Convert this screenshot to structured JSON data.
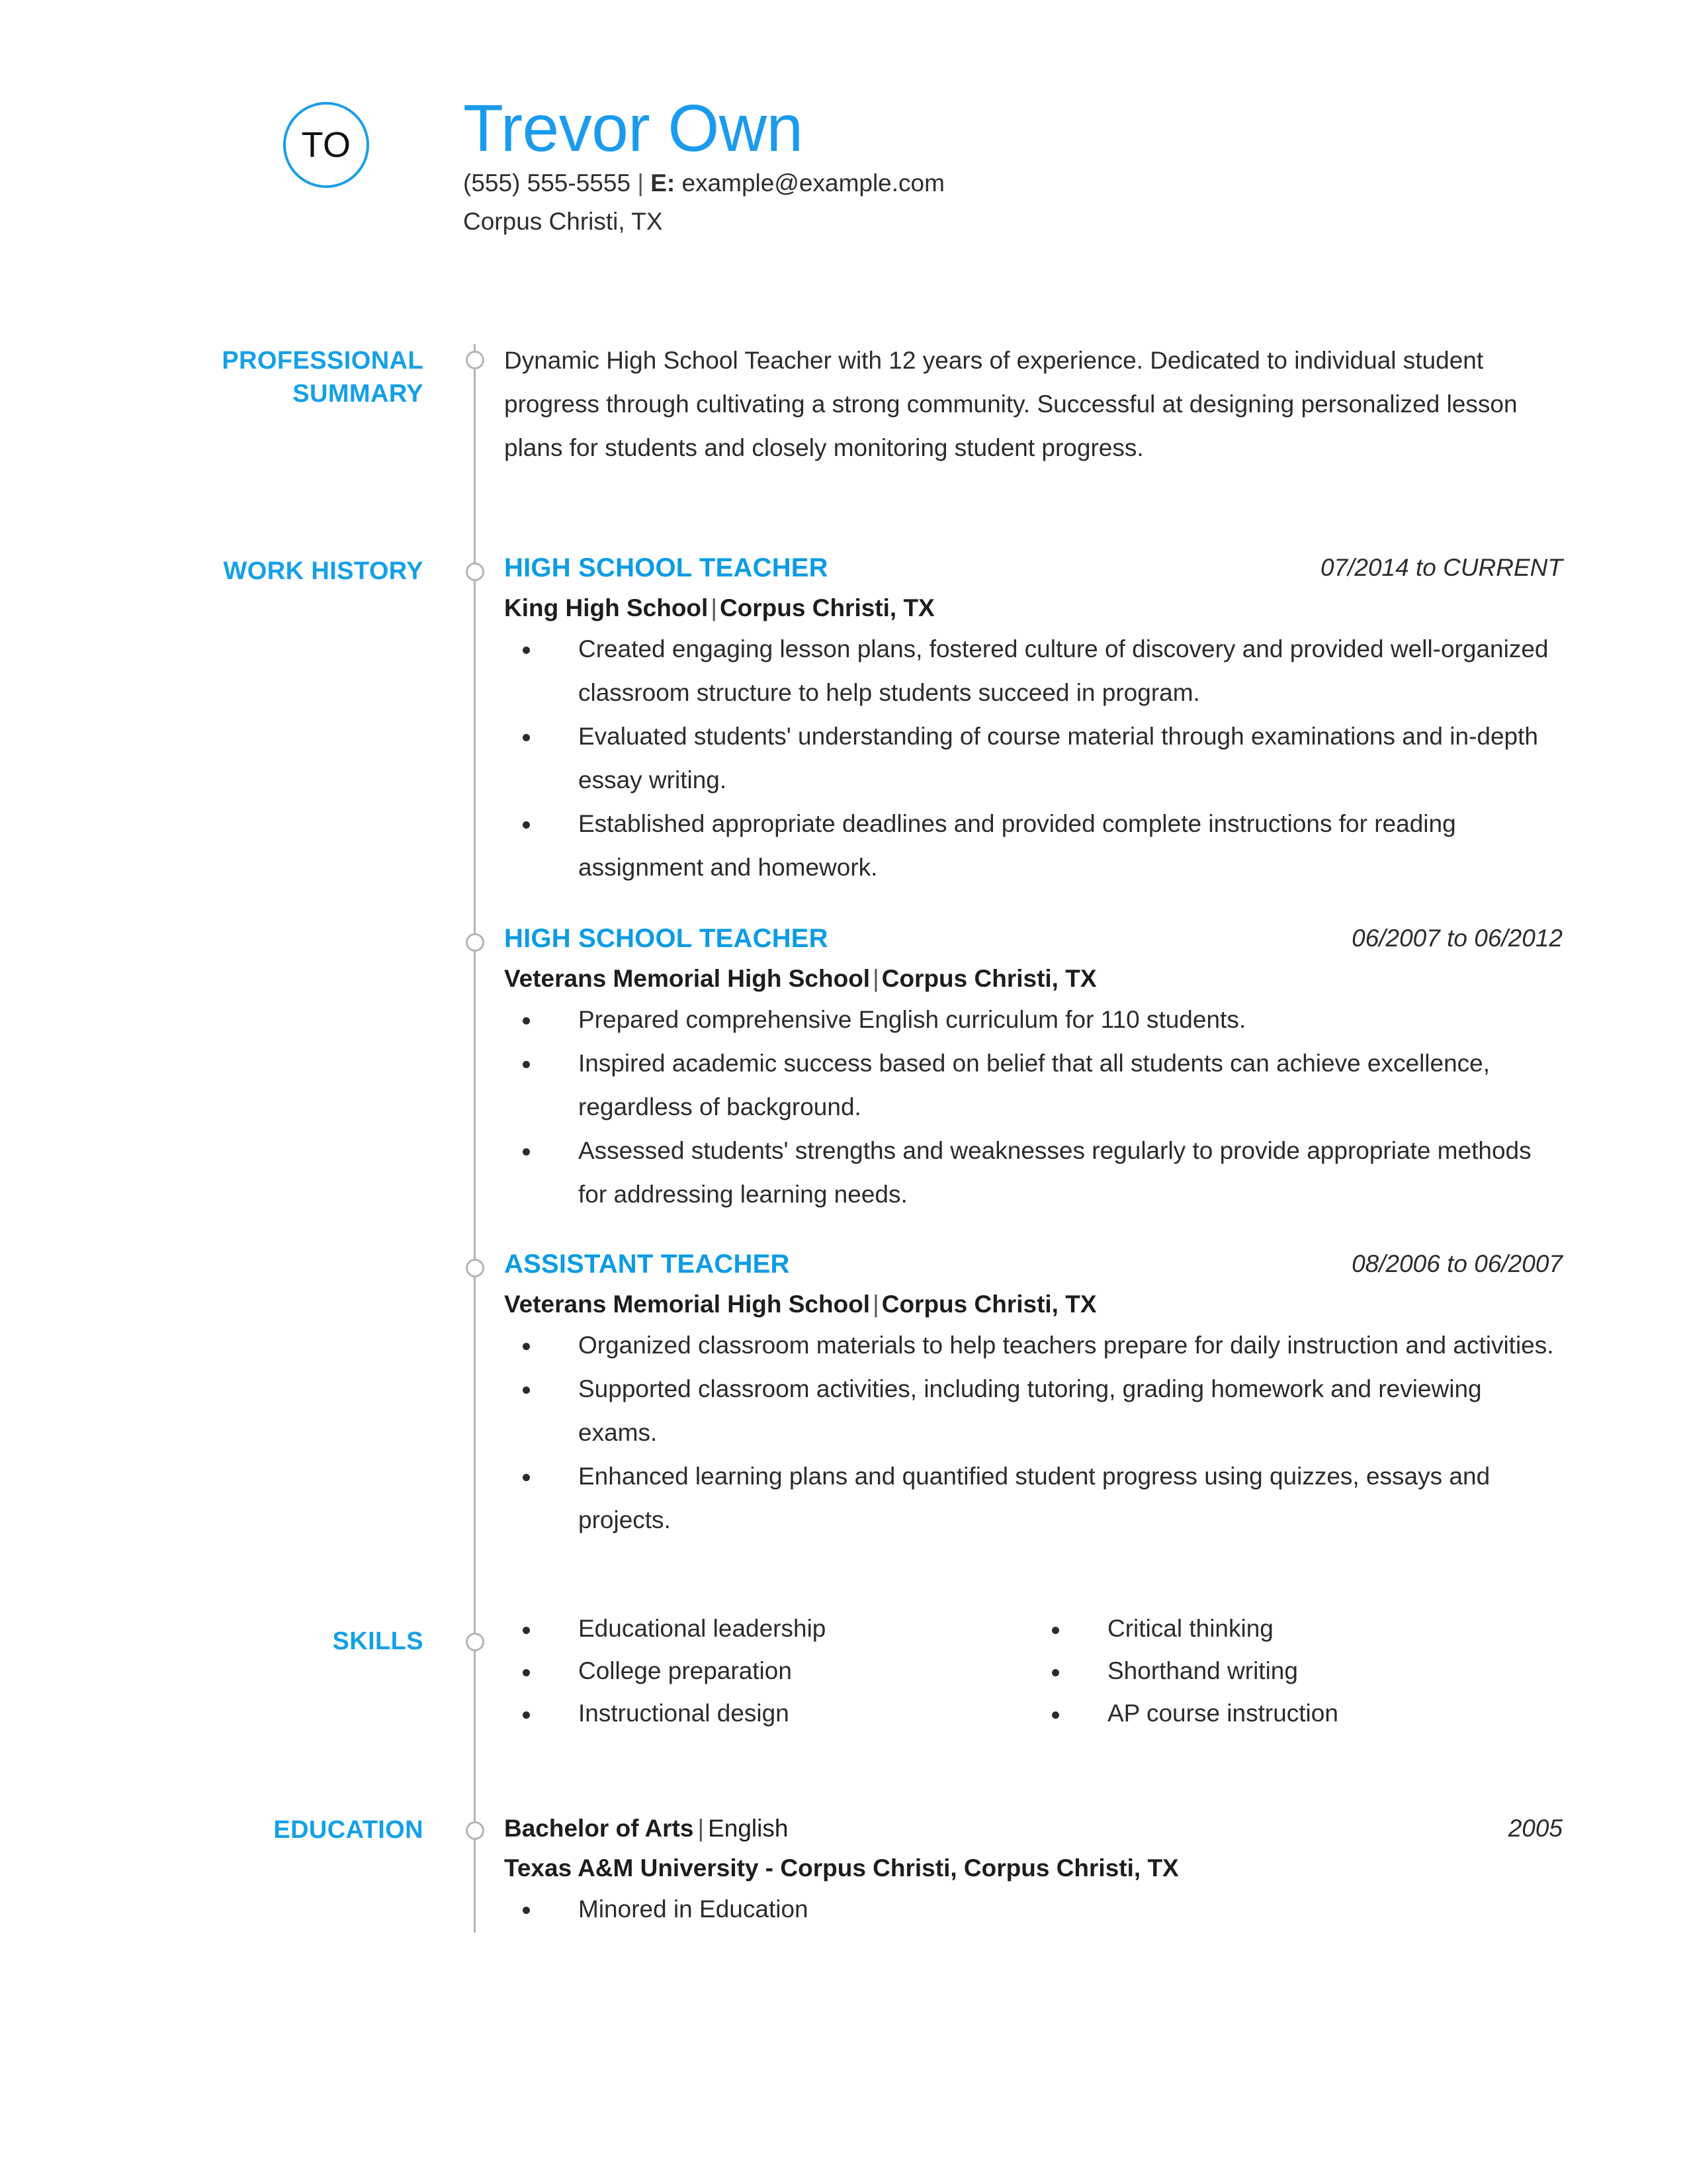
{
  "theme": {
    "accent_blue": "#0c9ce4",
    "name_blue": "#1a9bee",
    "rail_gray": "#b4b4b4",
    "body_text": "#2b2b2b"
  },
  "header": {
    "monogram": "TO",
    "name": "Trevor Own",
    "phone": "(555) 555-5555",
    "email_label": "E:",
    "email": "example@example.com",
    "separator": "|",
    "location": "Corpus Christi, TX"
  },
  "sections": {
    "summary": {
      "label_line1": "PROFESSIONAL",
      "label_line2": "SUMMARY",
      "text": "Dynamic High School Teacher with 12 years of experience. Dedicated to individual student progress through cultivating a strong community. Successful at designing personalized lesson plans for students and closely monitoring student progress."
    },
    "work_history": {
      "label": "WORK HISTORY",
      "jobs": [
        {
          "title": "HIGH SCHOOL TEACHER",
          "dates": "07/2014 to CURRENT",
          "company": "King High School",
          "location": "Corpus Christi, TX",
          "bullets": [
            "Created engaging lesson plans, fostered culture of discovery and provided well-organized classroom structure to help students succeed in program.",
            "Evaluated students' understanding of course material through examinations and in-depth essay writing.",
            "Established appropriate deadlines and provided complete instructions for reading assignment and homework."
          ]
        },
        {
          "title": "HIGH SCHOOL TEACHER",
          "dates": "06/2007 to 06/2012",
          "company": "Veterans Memorial High School",
          "location": "Corpus Christi, TX",
          "bullets": [
            "Prepared comprehensive English curriculum for 110 students.",
            "Inspired academic success based on belief that all students can achieve excellence, regardless of background.",
            "Assessed students' strengths and weaknesses regularly to provide appropriate methods for addressing learning needs."
          ]
        },
        {
          "title": "ASSISTANT TEACHER",
          "dates": "08/2006 to 06/2007",
          "company": "Veterans Memorial High School",
          "location": "Corpus Christi, TX",
          "bullets": [
            "Organized classroom materials to help teachers prepare for daily instruction and activities.",
            "Supported classroom activities, including tutoring, grading homework and reviewing exams.",
            "Enhanced learning plans and quantified student progress using quizzes, essays and projects."
          ]
        }
      ]
    },
    "skills": {
      "label": "SKILLS",
      "column_left": [
        "Educational leadership",
        "College preparation",
        "Instructional design"
      ],
      "column_right": [
        "Critical thinking",
        "Shorthand writing",
        "AP course instruction"
      ]
    },
    "education": {
      "label": "EDUCATION",
      "degree": "Bachelor of Arts",
      "major": "English",
      "year": "2005",
      "school": "Texas A&M University - Corpus Christi, Corpus Christi, TX",
      "bullets": [
        "Minored in Education"
      ]
    }
  }
}
